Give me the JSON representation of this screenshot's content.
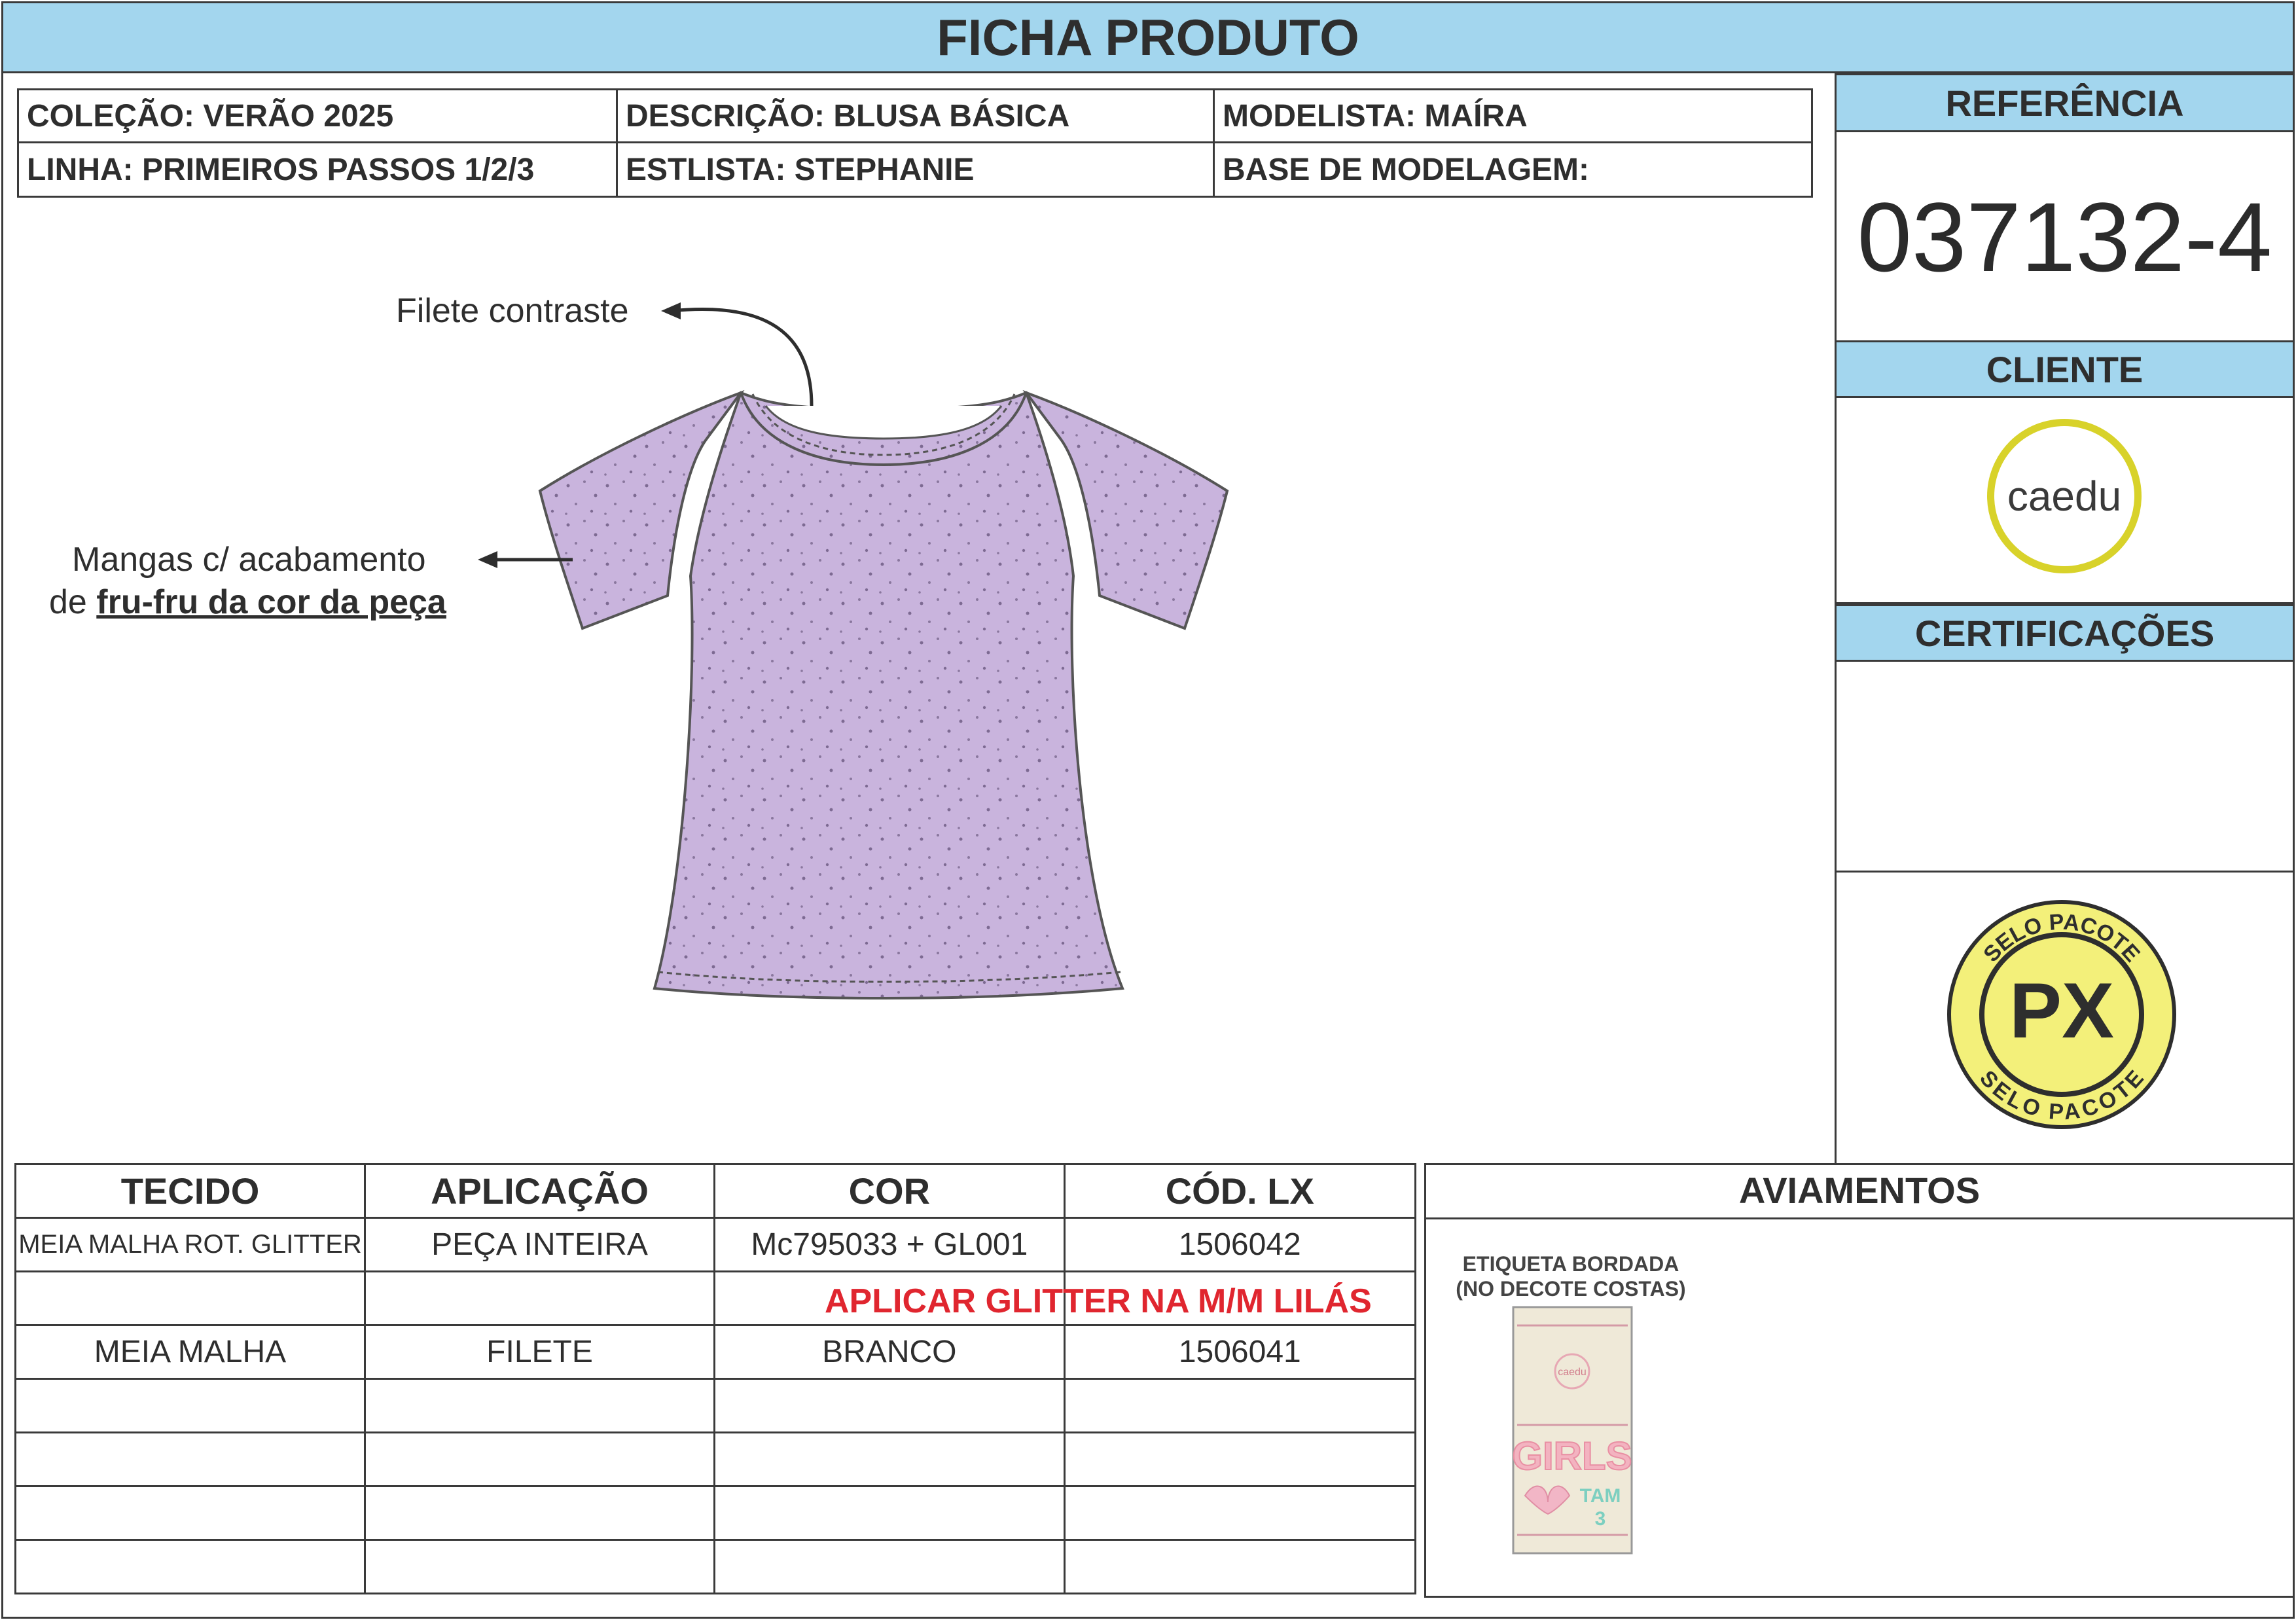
{
  "header": {
    "title": "FICHA PRODUTO"
  },
  "info": {
    "colecao": "COLEÇÃO: VERÃO 2025",
    "descricao": "DESCRIÇÃO: BLUSA BÁSICA",
    "modelista": "MODELISTA: MAÍRA",
    "linha": "LINHA: PRIMEIROS PASSOS 1/2/3",
    "estilista": "ESTLISTA: STEPHANIE",
    "base": "BASE DE MODELAGEM:"
  },
  "annotations": {
    "filete": "Filete contraste",
    "mangas_line1": "Mangas c/ acabamento",
    "mangas_prefix": "de ",
    "mangas_bold": "fru-fru da cor da peça"
  },
  "right_panel": {
    "referencia_label": "REFERÊNCIA",
    "referencia_value": "037132-4",
    "cliente_label": "CLIENTE",
    "cliente_logo_text": "caedu",
    "certificacoes_label": "CERTIFICAÇÕES",
    "selo_top": "SELO PACOTE",
    "selo_center": "PX",
    "selo_bottom": "SELO PACOTE"
  },
  "fabric_table": {
    "headers": [
      "TECIDO",
      "APLICAÇÃO",
      "COR",
      "CÓD. LX"
    ],
    "rows": [
      [
        "MEIA MALHA ROT. GLITTER",
        "PEÇA INTEIRA",
        "Mc795033 + GL001",
        "1506042"
      ],
      [
        "",
        "",
        "",
        ""
      ],
      [
        "MEIA MALHA",
        "FILETE",
        "BRANCO",
        "1506041"
      ],
      [
        "",
        "",
        "",
        ""
      ],
      [
        "",
        "",
        "",
        ""
      ],
      [
        "",
        "",
        "",
        ""
      ],
      [
        "",
        "",
        "",
        ""
      ]
    ],
    "note": "APLICAR GLITTER NA M/M LILÁS"
  },
  "aviamentos": {
    "title": "AVIAMENTOS",
    "item_title_line1": "ETIQUETA BORDADA",
    "item_title_line2": "(NO DECOTE COSTAS)",
    "label_brand": "caedu",
    "label_line": "GIRLS",
    "label_tam": "TAM",
    "label_size": "3"
  },
  "colors": {
    "accent_blue": "#a3d6ee",
    "garment_lilac": "#c9b4dd",
    "note_red": "#e0262f",
    "client_ring": "#d8d22a",
    "seal_yellow": "#f3f07a"
  }
}
